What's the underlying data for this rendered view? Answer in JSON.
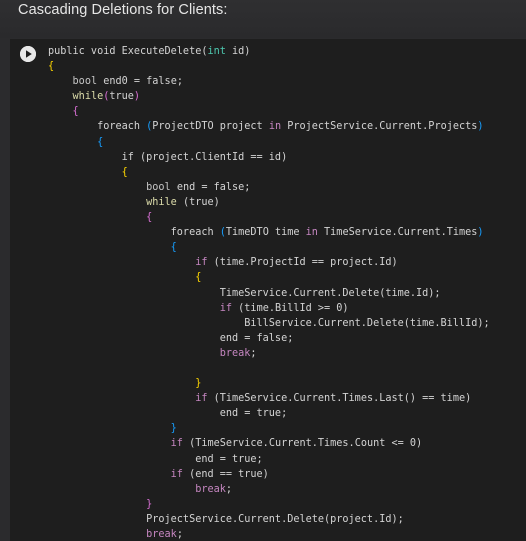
{
  "header": {
    "title": "Cascading Deletions for Clients:"
  },
  "run_button": {
    "icon": "play-icon"
  },
  "code": {
    "lines": [
      [
        [
          "t-pl",
          "public void ExecuteDelete("
        ],
        [
          "t-type",
          "int"
        ],
        [
          "t-pl",
          " id)"
        ]
      ],
      [
        [
          "t-br1",
          "{"
        ]
      ],
      [
        [
          "t-pl",
          "    "
        ],
        [
          "t-kw",
          "bool"
        ],
        [
          "t-pl",
          " end0 = false;"
        ]
      ],
      [
        [
          "t-pl",
          "    "
        ],
        [
          "t-fn",
          "while"
        ],
        [
          "t-br2",
          "("
        ],
        [
          "t-pl",
          "true"
        ],
        [
          "t-br2",
          ")"
        ]
      ],
      [
        [
          "t-pl",
          "    "
        ],
        [
          "t-br2",
          "{"
        ]
      ],
      [
        [
          "t-pl",
          "        foreach "
        ],
        [
          "t-br3",
          "("
        ],
        [
          "t-pl",
          "ProjectDTO project "
        ],
        [
          "t-ctl",
          "in"
        ],
        [
          "t-pl",
          " ProjectService.Current.Projects"
        ],
        [
          "t-br3",
          ")"
        ]
      ],
      [
        [
          "t-pl",
          "        "
        ],
        [
          "t-br3",
          "{"
        ]
      ],
      [
        [
          "t-pl",
          "            if (project.ClientId == id)"
        ]
      ],
      [
        [
          "t-pl",
          "            "
        ],
        [
          "t-br1",
          "{"
        ]
      ],
      [
        [
          "t-pl",
          "                "
        ],
        [
          "t-kw",
          "bool"
        ],
        [
          "t-pl",
          " end = false;"
        ]
      ],
      [
        [
          "t-pl",
          "                "
        ],
        [
          "t-fn",
          "while"
        ],
        [
          "t-pl",
          " (true)"
        ]
      ],
      [
        [
          "t-pl",
          "                "
        ],
        [
          "t-br2",
          "{"
        ]
      ],
      [
        [
          "t-pl",
          "                    foreach "
        ],
        [
          "t-br3",
          "("
        ],
        [
          "t-pl",
          "TimeDTO time "
        ],
        [
          "t-ctl",
          "in"
        ],
        [
          "t-pl",
          " TimeService.Current.Times"
        ],
        [
          "t-br3",
          ")"
        ]
      ],
      [
        [
          "t-pl",
          "                    "
        ],
        [
          "t-br3",
          "{"
        ]
      ],
      [
        [
          "t-pl",
          "                        "
        ],
        [
          "t-ctl",
          "if"
        ],
        [
          "t-pl",
          " (time.ProjectId == project.Id)"
        ]
      ],
      [
        [
          "t-pl",
          "                        "
        ],
        [
          "t-br1",
          "{"
        ]
      ],
      [
        [
          "t-pl",
          "                            TimeService.Current.Delete(time.Id);"
        ]
      ],
      [
        [
          "t-pl",
          "                            "
        ],
        [
          "t-ctl",
          "if"
        ],
        [
          "t-pl",
          " (time.BillId >= 0)"
        ]
      ],
      [
        [
          "t-pl",
          "                                BillService.Current.Delete(time.BillId);"
        ]
      ],
      [
        [
          "t-pl",
          "                            end = false;"
        ]
      ],
      [
        [
          "t-pl",
          "                            "
        ],
        [
          "t-ctl",
          "break"
        ],
        [
          "t-pl",
          ";"
        ]
      ],
      [
        [
          "t-pl",
          ""
        ]
      ],
      [
        [
          "t-pl",
          "                        "
        ],
        [
          "t-br1",
          "}"
        ]
      ],
      [
        [
          "t-pl",
          "                        "
        ],
        [
          "t-ctl",
          "if"
        ],
        [
          "t-pl",
          " (TimeService.Current.Times.Last() == time)"
        ]
      ],
      [
        [
          "t-pl",
          "                            end = true;"
        ]
      ],
      [
        [
          "t-pl",
          "                    "
        ],
        [
          "t-br3",
          "}"
        ]
      ],
      [
        [
          "t-pl",
          "                    "
        ],
        [
          "t-ctl",
          "if"
        ],
        [
          "t-pl",
          " (TimeService.Current.Times.Count <= 0)"
        ]
      ],
      [
        [
          "t-pl",
          "                        end = true;"
        ]
      ],
      [
        [
          "t-pl",
          "                    "
        ],
        [
          "t-ctl",
          "if"
        ],
        [
          "t-pl",
          " (end == true)"
        ]
      ],
      [
        [
          "t-pl",
          "                        "
        ],
        [
          "t-ctl",
          "break"
        ],
        [
          "t-pl",
          ";"
        ]
      ],
      [
        [
          "t-pl",
          "                "
        ],
        [
          "t-br2",
          "}"
        ]
      ],
      [
        [
          "t-pl",
          "                ProjectService.Current.Delete(project.Id);"
        ]
      ],
      [
        [
          "t-pl",
          "                "
        ],
        [
          "t-ctl",
          "break"
        ],
        [
          "t-pl",
          ";"
        ]
      ]
    ]
  }
}
